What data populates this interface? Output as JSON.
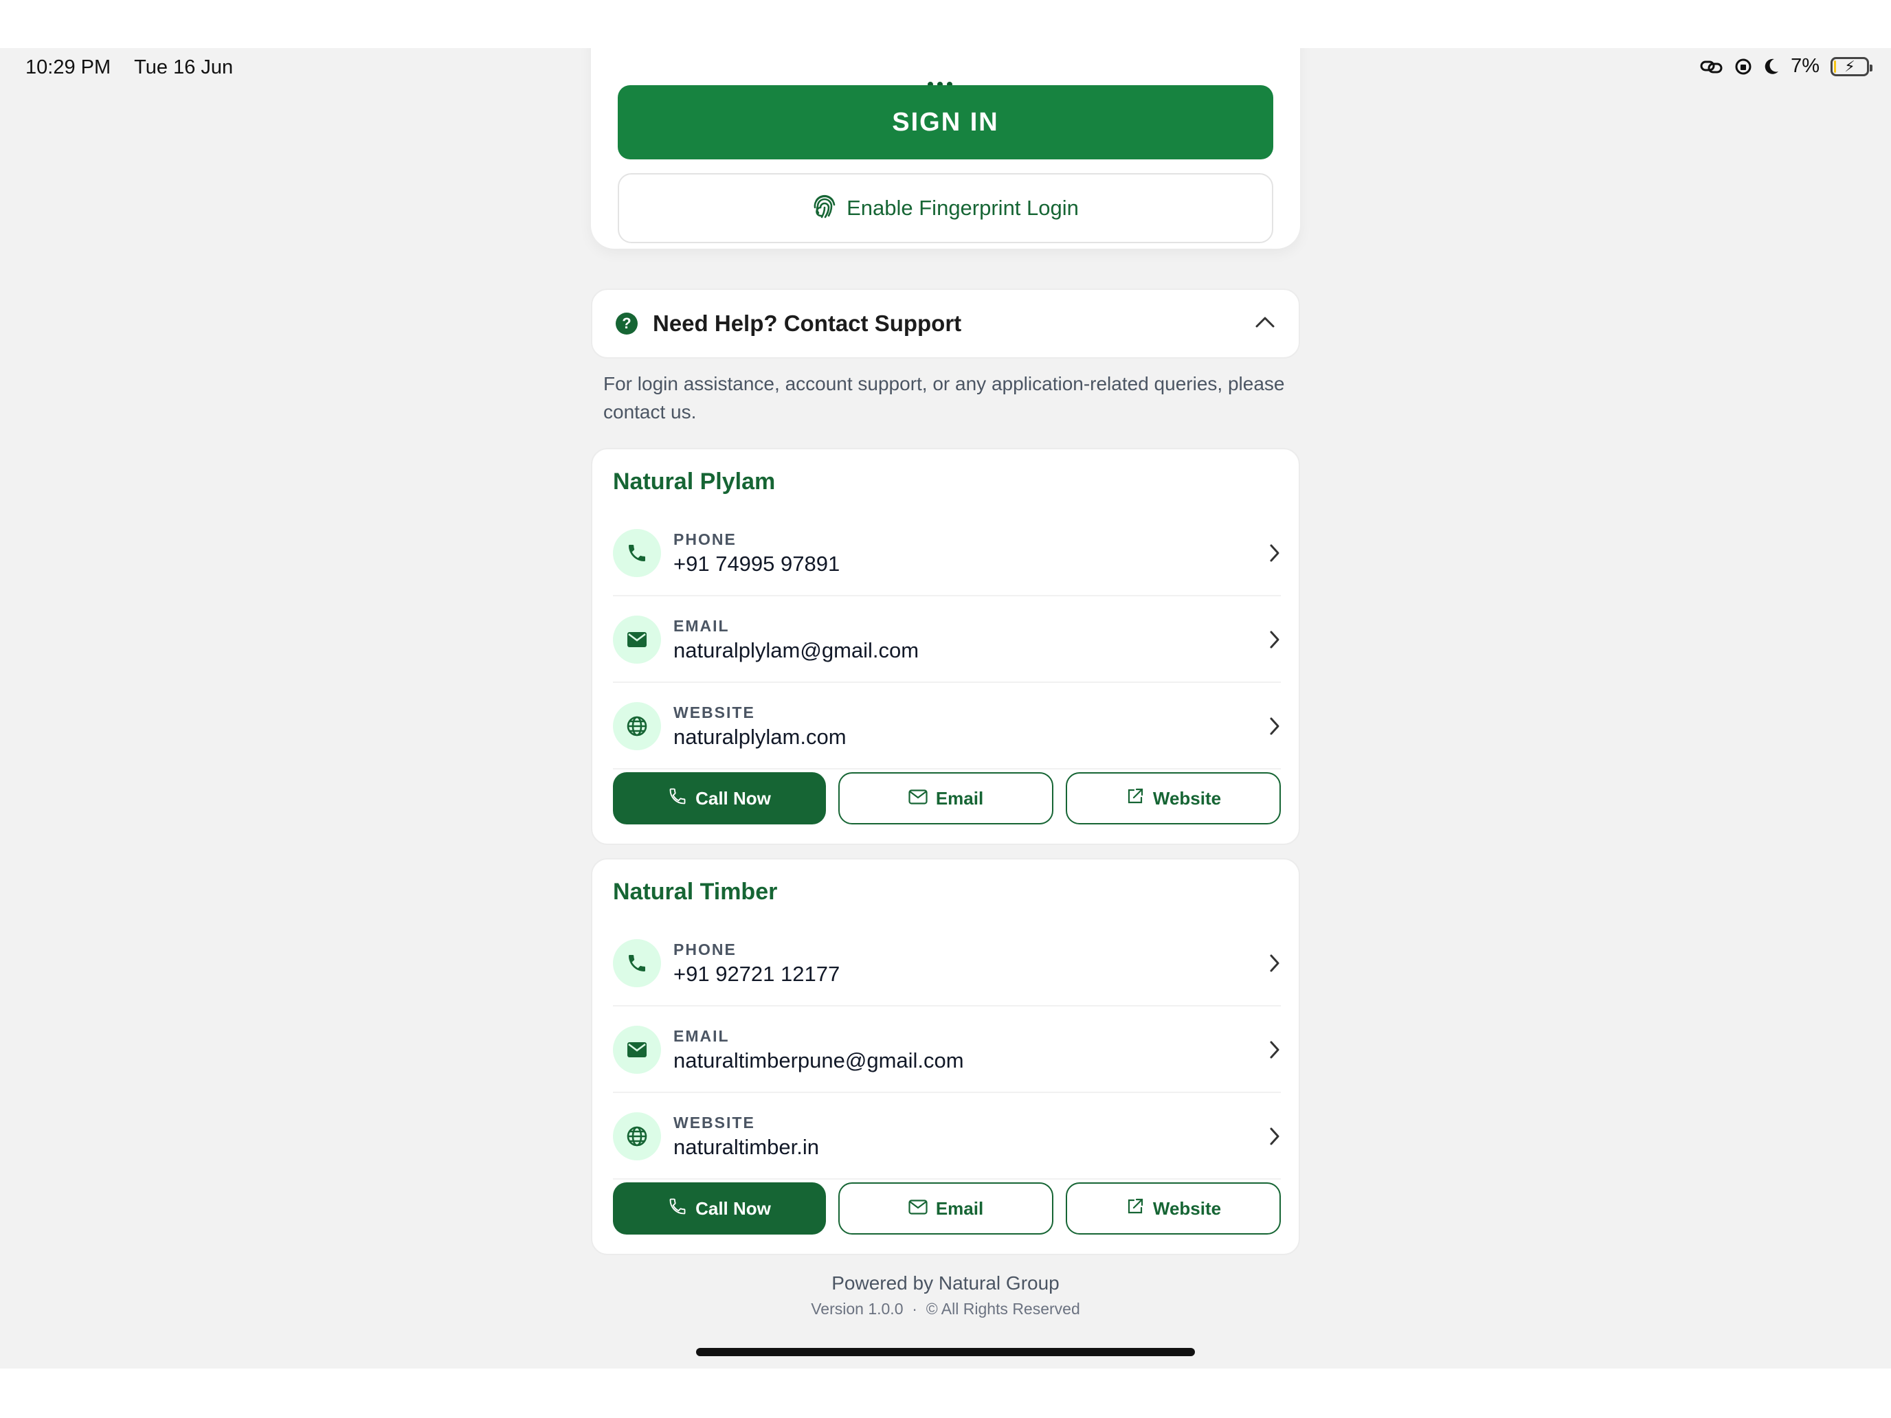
{
  "status_bar": {
    "time": "10:29 PM",
    "date": "Tue 16 Jun",
    "battery_percent": "7%",
    "battery_level": 0.07
  },
  "login": {
    "sign_in_label": "SIGN IN",
    "fingerprint_label": "Enable Fingerprint Login"
  },
  "help": {
    "title": "Need Help? Contact Support",
    "description": "For login assistance, account support, or any application-related queries, please contact us."
  },
  "companies": [
    {
      "name": "Natural Plylam",
      "contacts": [
        {
          "label": "PHONE",
          "value": "+91 74995 97891",
          "icon": "phone-icon"
        },
        {
          "label": "EMAIL",
          "value": "naturalplylam@gmail.com",
          "icon": "mail-icon"
        },
        {
          "label": "WEBSITE",
          "value": "naturalplylam.com",
          "icon": "globe-icon"
        }
      ],
      "actions": {
        "call": "Call Now",
        "email": "Email",
        "website": "Website"
      }
    },
    {
      "name": "Natural Timber",
      "contacts": [
        {
          "label": "PHONE",
          "value": "+91 92721 12177",
          "icon": "phone-icon"
        },
        {
          "label": "EMAIL",
          "value": "naturaltimberpune@gmail.com",
          "icon": "mail-icon"
        },
        {
          "label": "WEBSITE",
          "value": "naturaltimber.in",
          "icon": "globe-icon"
        }
      ],
      "actions": {
        "call": "Call Now",
        "email": "Email",
        "website": "Website"
      }
    }
  ],
  "footer": {
    "powered_by": "Powered by Natural Group",
    "version": "Version 1.0.0",
    "separator": "·",
    "rights": "© All Rights Reserved"
  },
  "colors": {
    "primary_green": "#178340",
    "dark_green": "#166534",
    "icon_bg": "#dcfce7",
    "background": "#f2f2f2"
  }
}
